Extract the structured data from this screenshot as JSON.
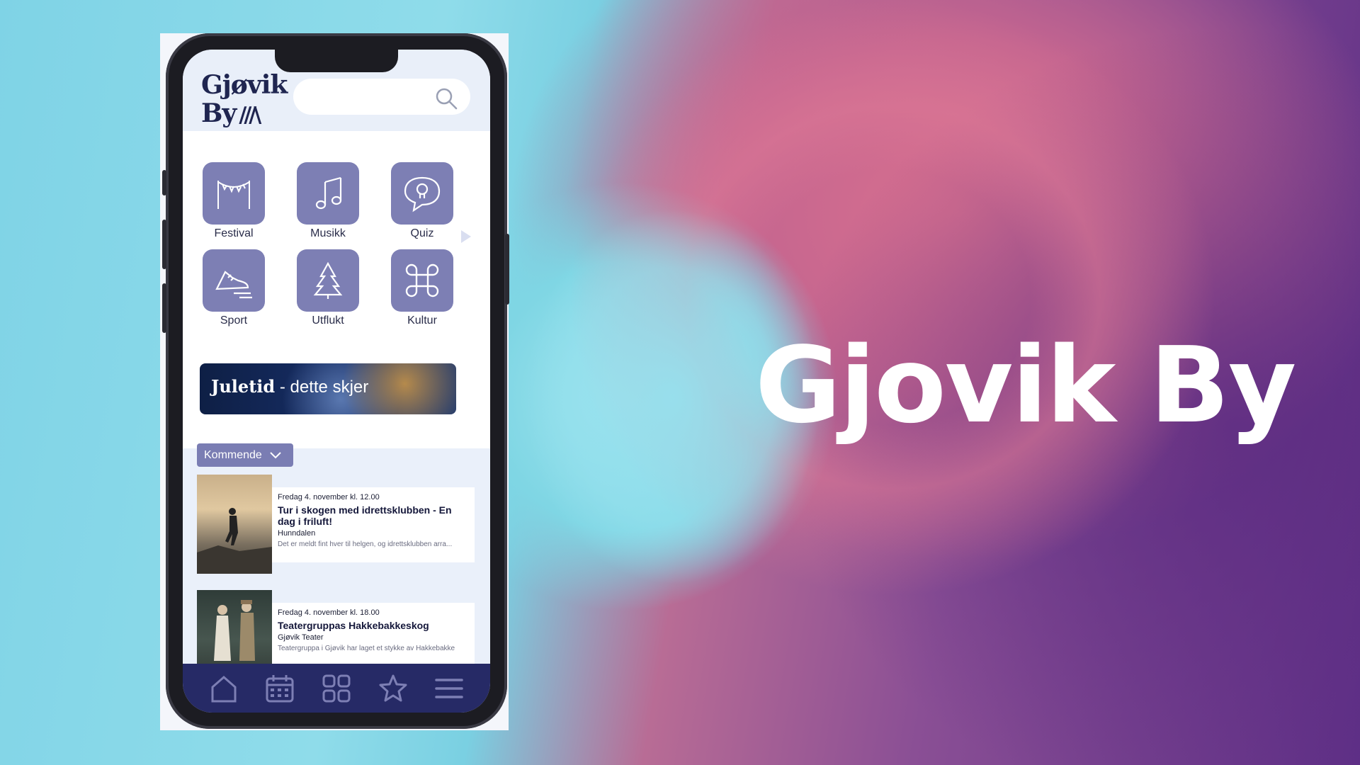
{
  "headline": "Gjovik By",
  "app": {
    "logo_line1": "Gjøvik",
    "logo_line2": "By",
    "logo_slashes": "///\\",
    "search": {
      "placeholder": "",
      "icon": "search-icon"
    },
    "categories": [
      {
        "label": "Festival",
        "icon": "bunting-icon"
      },
      {
        "label": "Musikk",
        "icon": "music-note-icon"
      },
      {
        "label": "Quiz",
        "icon": "lightbulb-speech-icon"
      },
      {
        "label": "Sport",
        "icon": "shoe-icon"
      },
      {
        "label": "Utflukt",
        "icon": "tree-icon"
      },
      {
        "label": "Kultur",
        "icon": "command-icon"
      }
    ],
    "banner": {
      "bold": "Juletid",
      "rest": " - dette skjer"
    },
    "sort_label": "Kommende",
    "events": [
      {
        "date": "Fredag 4. november kl. 12.00",
        "title": "Tur i skogen med idrettsklubben - En dag i friluft!",
        "place": "Hunndalen",
        "desc": "Det er meldt fint hver til helgen, og idrettsklubben arra..."
      },
      {
        "date": "Fredag 4. november kl. 18.00",
        "title": "Teatergruppas Hakkebakkeskog",
        "place": "Gjøvik Teater",
        "desc": "Teatergruppa i Gjøvik har laget et stykke av Hakkebakke"
      }
    ],
    "tabs": [
      "home-icon",
      "calendar-icon",
      "grid-icon",
      "star-icon",
      "menu-icon"
    ]
  },
  "colors": {
    "accent": "#7d7fb4",
    "navbar": "#262a66",
    "brand": "#1f2550"
  }
}
